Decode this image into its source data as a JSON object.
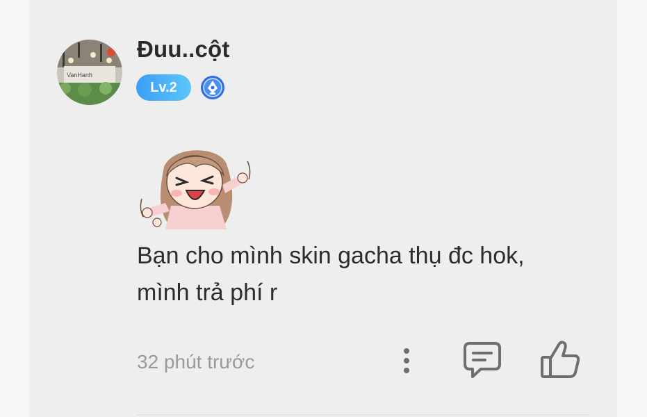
{
  "comment": {
    "username": "Đuu..cột",
    "level_badge": "Lv.2",
    "text_line1": "Bạn cho mình skin gacha thụ đc hok,",
    "text_line2": "mình trả phí r",
    "timestamp": "32 phút trước",
    "avatar_sign_text": "VanHanh",
    "icons": {
      "avatar": "user-avatar",
      "badge": "pen-badge-icon",
      "sticker": "excited-girl-sticker",
      "more": "more-vertical-icon",
      "reply": "reply-comment-icon",
      "like": "thumbs-up-icon"
    },
    "colors": {
      "level_badge": "#3a9ef5",
      "icon_gray": "#6e6e6e"
    }
  }
}
